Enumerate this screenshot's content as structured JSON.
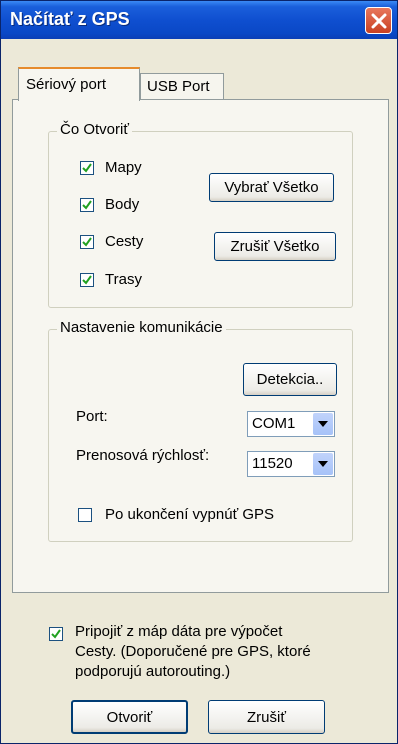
{
  "window": {
    "title": "Načítať z GPS"
  },
  "tabs": [
    {
      "label": "Sériový port"
    },
    {
      "label": "USB Port"
    }
  ],
  "open_group": {
    "legend": "Čo Otvoriť",
    "items": [
      {
        "label": "Mapy",
        "checked": true
      },
      {
        "label": "Body",
        "checked": true
      },
      {
        "label": "Cesty",
        "checked": true
      },
      {
        "label": "Trasy",
        "checked": true
      }
    ],
    "select_all_label": "Vybrať Všetko",
    "clear_all_label": "Zrušiť Všetko"
  },
  "comm_group": {
    "legend": "Nastavenie komunikácie",
    "detect_label": "Detekcia..",
    "port_label": "Port:",
    "port_value": "COM1",
    "baud_label": "Prenosová rýchlosť:",
    "baud_value": "11520",
    "turn_off_label": "Po ukončení vypnúť GPS",
    "turn_off_checked": false
  },
  "attach": {
    "checked": true,
    "line1": "Pripojiť z máp dáta pre výpočet",
    "line2": "Cesty.  (Doporučené pre GPS, ktoré",
    "line3": "podporujú autorouting.)"
  },
  "buttons": {
    "open_label": "Otvoriť",
    "cancel_label": "Zrušiť"
  }
}
